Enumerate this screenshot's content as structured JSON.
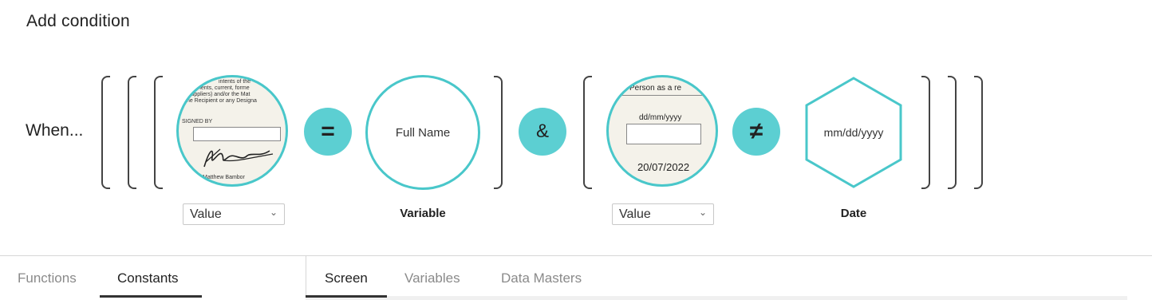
{
  "header": {
    "title": "Add condition"
  },
  "condition": {
    "prefix": "When...",
    "operand1": {
      "type_label": "Value",
      "thumb": {
        "lines": [
          "intents of the",
          "nents, current, forme",
          "suppliers) and/or the Mat",
          "the Recipient or any Designa"
        ],
        "signed_by": "SIGNED BY",
        "signer": "Matthew Bambor"
      }
    },
    "operator1": "=",
    "operand2": {
      "text": "Full Name",
      "type_label": "Variable"
    },
    "joiner": "&",
    "operand3": {
      "type_label": "Value",
      "thumb": {
        "header": "Person as a re",
        "format": "dd/mm/yyyy",
        "value": "20/07/2022"
      }
    },
    "operator2": "≠",
    "operand4": {
      "text": "mm/dd/yyyy",
      "type_label": "Date"
    }
  },
  "left_tabs": [
    {
      "label": "Functions",
      "active": false
    },
    {
      "label": "Constants",
      "active": true
    }
  ],
  "right_tabs": [
    {
      "label": "Screen",
      "active": true
    },
    {
      "label": "Variables",
      "active": false
    },
    {
      "label": "Data Masters",
      "active": false
    }
  ],
  "colors": {
    "accent": "#5ccfd2",
    "border": "#49c7ca"
  },
  "icons": {
    "dropdown": "chevron-down-icon"
  }
}
